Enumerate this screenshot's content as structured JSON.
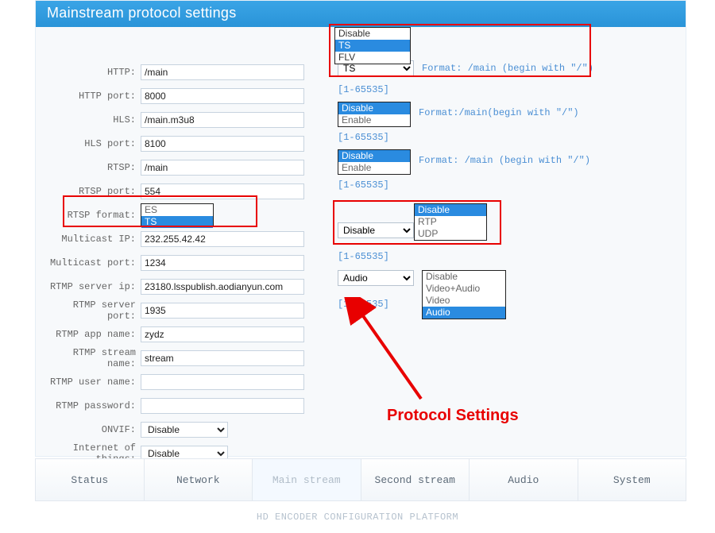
{
  "title": "Mainstream protocol settings",
  "annotation": "Protocol Settings",
  "rows": {
    "http": {
      "label": "HTTP:",
      "value": "/main"
    },
    "http_port": {
      "label": "HTTP port:",
      "value": "8000"
    },
    "hls": {
      "label": "HLS:",
      "value": "/main.m3u8"
    },
    "hls_port": {
      "label": "HLS port:",
      "value": "8100"
    },
    "rtsp": {
      "label": "RTSP:",
      "value": "/main"
    },
    "rtsp_port": {
      "label": "RTSP port:",
      "value": "554"
    },
    "rtsp_format": {
      "label": "RTSP format:",
      "value": ""
    },
    "mcast_ip": {
      "label": "Multicast IP:",
      "value": "232.255.42.42"
    },
    "mcast_port": {
      "label": "Multicast port:",
      "value": "1234"
    },
    "rtmp_ip": {
      "label": "RTMP server ip:",
      "value": "23180.lsspublish.aodianyun.com"
    },
    "rtmp_port": {
      "label": "RTMP server port:",
      "value": "1935"
    },
    "rtmp_app": {
      "label": "RTMP app name:",
      "value": "zydz"
    },
    "rtmp_stream": {
      "label": "RTMP stream name:",
      "value": "stream"
    },
    "rtmp_user": {
      "label": "RTMP user name:",
      "value": ""
    },
    "rtmp_pass": {
      "label": "RTMP password:",
      "value": ""
    },
    "onvif": {
      "label": "ONVIF:",
      "value": "Disable"
    },
    "iot": {
      "label": "Internet of things:",
      "value": "Disable"
    }
  },
  "hints": {
    "range": "[1-65535]",
    "fmt_main_slash_ucfirst": "Format: /main (begin with \"/\")",
    "fmt_main_lc": "Format:/main(begin with \"/\")",
    "fmt_main_slash": "Format: /main (begin with \"/\")"
  },
  "lists": {
    "ts_flv": {
      "options": [
        "Disable",
        "TS",
        "FLV"
      ],
      "selected": "TS"
    },
    "hls_en": {
      "options": [
        "Disable",
        "Enable"
      ],
      "selected": "Disable"
    },
    "rtsp_en": {
      "options": [
        "Disable",
        "Enable"
      ],
      "selected": "Disable"
    },
    "rtsp_fmt": {
      "options": [
        "ES",
        "TS"
      ],
      "selected": "TS"
    },
    "mcast_pro": {
      "options": [
        "Disable",
        "RTP",
        "UDP"
      ],
      "selected": "Disable"
    },
    "mcast_sel": {
      "value": "Disable"
    },
    "rtmp_av": {
      "options": [
        "Disable",
        "Video+Audio",
        "Video",
        "Audio"
      ],
      "selected": "Audio"
    },
    "rtmp_sel": {
      "value": "Audio"
    },
    "ts_sel": {
      "value": "TS"
    }
  },
  "nav": {
    "items": [
      "Status",
      "Network",
      "Main stream",
      "Second stream",
      "Audio",
      "System"
    ],
    "active": "Main stream"
  },
  "footer": "HD ENCODER CONFIGURATION PLATFORM"
}
